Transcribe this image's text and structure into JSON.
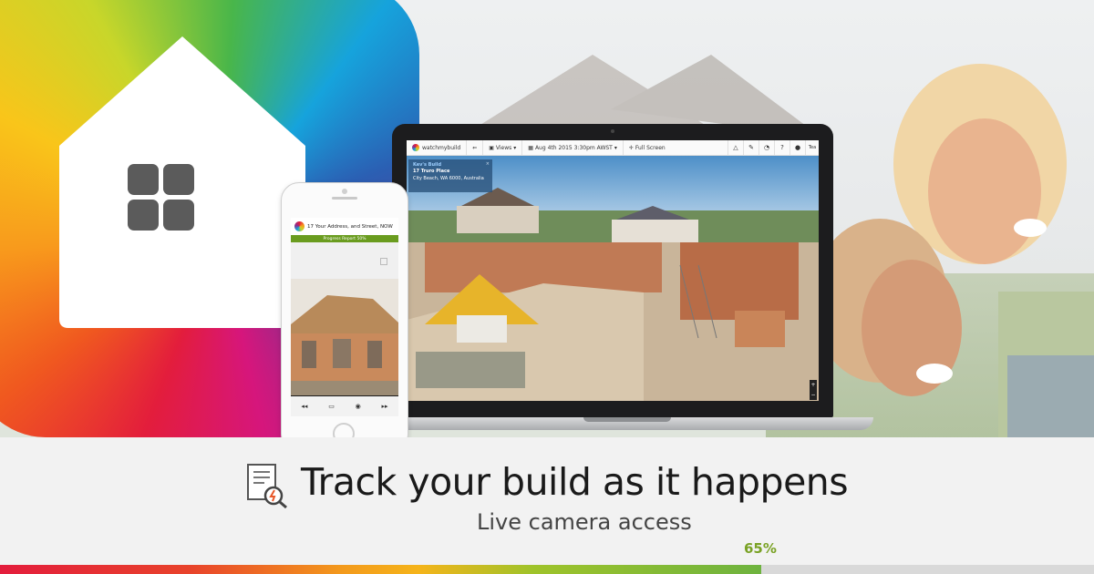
{
  "hero": {
    "app_icon": "grid-icon",
    "laptop": {
      "brand": "watchmybuild",
      "toolbar": {
        "back_icon": "arrow-left-icon",
        "views_label": "Views",
        "date_label": "Aug 4th 2015 3:30pm AWST",
        "fullscreen_label": "Full Screen",
        "right_icons": [
          "bell-icon",
          "wrench-icon",
          "gauge-icon",
          "help-icon",
          "user-icon"
        ],
        "user_label": "Tea"
      },
      "info_card": {
        "title": "Kev's Build",
        "address": "17 Truro Place",
        "location": "City Beach, WA 6000, Australia",
        "close": "×"
      },
      "zoom": {
        "in": "+",
        "out": "−"
      }
    },
    "phone": {
      "address": "17 Your Address, and Street, NOW",
      "progress_label": "Progress Report 50%",
      "controls": [
        "◂◂",
        "▭",
        "◉",
        "▸▸"
      ]
    }
  },
  "caption": {
    "icon": "report-search-icon",
    "headline": "Track your build as it happens",
    "subline": "Live camera access",
    "progress_percent": "65%",
    "progress_value": 0.696
  },
  "colors": {
    "accent_green": "#7aa225",
    "progress_green": "#6a9c1f"
  }
}
